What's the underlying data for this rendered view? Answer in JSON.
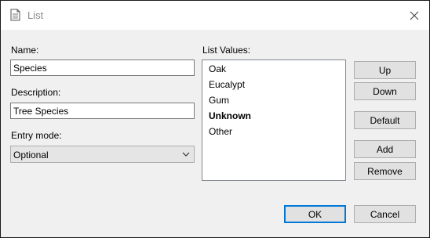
{
  "window": {
    "title": "List",
    "title_icon": "document-icon",
    "close_icon": "close-icon"
  },
  "form": {
    "name_label": "Name:",
    "name_value": "Species",
    "description_label": "Description:",
    "description_value": "Tree Species",
    "entry_mode_label": "Entry mode:",
    "entry_mode_value": "Optional",
    "list_values_label": "List Values:"
  },
  "list_values": [
    {
      "label": "Oak",
      "bold": false
    },
    {
      "label": "Eucalypt",
      "bold": false
    },
    {
      "label": "Gum",
      "bold": false
    },
    {
      "label": "Unknown",
      "bold": true
    },
    {
      "label": "Other",
      "bold": false
    }
  ],
  "buttons": {
    "up": "Up",
    "down": "Down",
    "default": "Default",
    "add": "Add",
    "remove": "Remove",
    "ok": "OK",
    "cancel": "Cancel"
  },
  "colors": {
    "focus_border": "#0078d7",
    "client_bg": "#f0f0f0"
  }
}
